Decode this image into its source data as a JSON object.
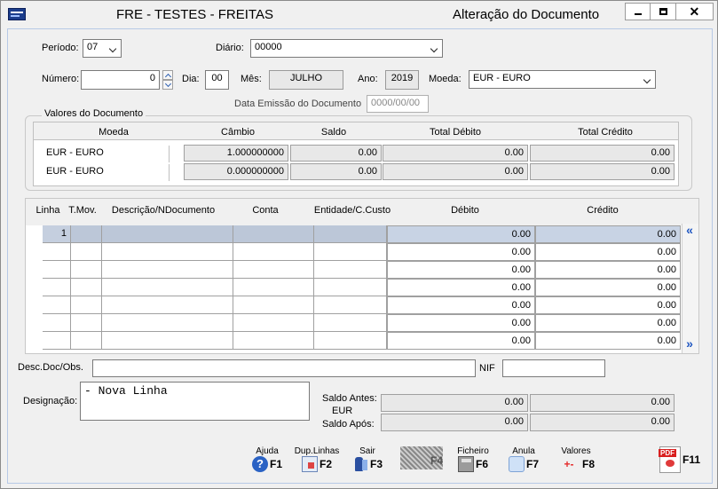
{
  "window": {
    "app_title": "FRE - TESTES - FREITAS",
    "window_title": "Alteração do Documento",
    "controls": {
      "minimize": "—",
      "maximize": "□",
      "close": "✕"
    }
  },
  "header": {
    "periodo_label": "Período:",
    "periodo_value": "07",
    "diario_label": "Diário:",
    "diario_value": "00000",
    "numero_label": "Número:",
    "numero_value": "0",
    "dia_label": "Dia:",
    "dia_value": "00",
    "mes_label": "Mês:",
    "mes_value": "JULHO",
    "ano_label": "Ano:",
    "ano_value": "2019",
    "moeda_label": "Moeda:",
    "moeda_value": "EUR - EURO",
    "data_emissao_label": "Data Emissão do Documento",
    "data_emissao_value": "0000/00/00"
  },
  "valores": {
    "group_label": "Valores do Documento",
    "columns": [
      "Moeda",
      "Câmbio",
      "Saldo",
      "Total Débito",
      "Total Crédito"
    ],
    "rows": [
      {
        "moeda": "EUR - EURO",
        "cambio": "1.000000000",
        "saldo": "0.00",
        "debito": "0.00",
        "credito": "0.00"
      },
      {
        "moeda": "EUR - EURO",
        "cambio": "0.000000000",
        "saldo": "0.00",
        "debito": "0.00",
        "credito": "0.00"
      }
    ]
  },
  "grid": {
    "columns": [
      "Linha",
      "T.Mov.",
      "Descrição/NDocumento",
      "Conta",
      "Entidade/C.Custo",
      "Débito",
      "Crédito"
    ],
    "rows": [
      {
        "linha": "1",
        "debito": "0.00",
        "credito": "0.00"
      },
      {
        "linha": "",
        "debito": "0.00",
        "credito": "0.00"
      },
      {
        "linha": "",
        "debito": "0.00",
        "credito": "0.00"
      },
      {
        "linha": "",
        "debito": "0.00",
        "credito": "0.00"
      },
      {
        "linha": "",
        "debito": "0.00",
        "credito": "0.00"
      },
      {
        "linha": "",
        "debito": "0.00",
        "credito": "0.00"
      },
      {
        "linha": "",
        "debito": "0.00",
        "credito": "0.00"
      }
    ],
    "scroll_up": "«",
    "scroll_down": "»"
  },
  "footer": {
    "desc_label": "Desc.Doc/Obs.",
    "desc_value": "",
    "nif_label": "NIF",
    "nif_value": "",
    "designacao_label": "Designação:",
    "designacao_value": "- Nova Linha",
    "saldo_antes_label": "Saldo Antes:",
    "saldo_currency": "EUR",
    "saldo_apos_label": "Saldo Após:",
    "saldo_antes_debito": "0.00",
    "saldo_antes_credito": "0.00",
    "saldo_apos_debito": "0.00",
    "saldo_apos_credito": "0.00"
  },
  "function_keys": [
    {
      "label": "Ajuda",
      "key": "F1",
      "icon": "help-icon"
    },
    {
      "label": "Dup.Linhas",
      "key": "F2",
      "icon": "duplicate-lines-icon"
    },
    {
      "label": "Sair",
      "key": "F3",
      "icon": "exit-icon"
    },
    {
      "label": "",
      "key": "F4",
      "icon": "print-icon"
    },
    {
      "label": "Ficheiro",
      "key": "F6",
      "icon": "file-icon"
    },
    {
      "label": "Anula",
      "key": "F7",
      "icon": "annul-icon"
    },
    {
      "label": "Valores",
      "key": "F8",
      "icon": "values-icon"
    },
    {
      "label": "",
      "key": "F11",
      "icon": "pdf-icon"
    }
  ]
}
